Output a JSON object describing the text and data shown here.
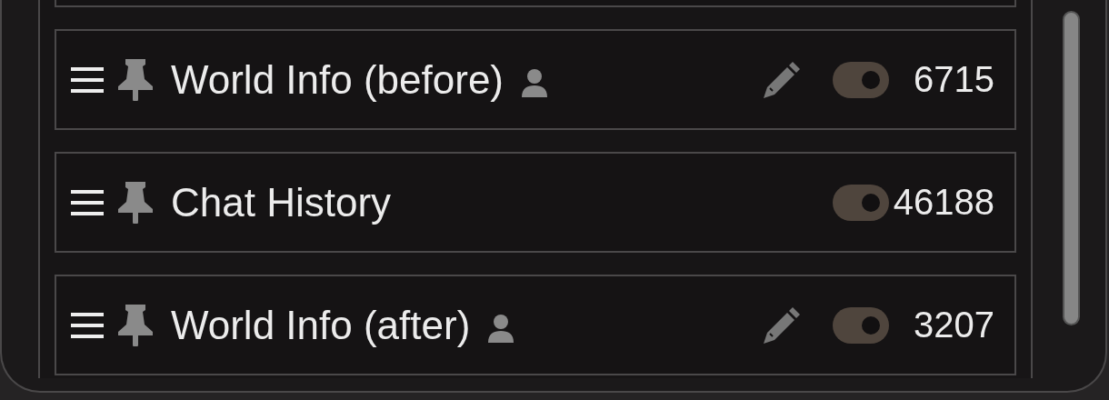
{
  "prompt_list": [
    {
      "name": "World Info (before)",
      "owner_icon": true,
      "editable": true,
      "on": true,
      "tokens": "6715"
    },
    {
      "name": "Chat History",
      "owner_icon": false,
      "editable": false,
      "on": true,
      "tokens": "46188"
    },
    {
      "name": "World Info (after)",
      "owner_icon": true,
      "editable": true,
      "on": true,
      "tokens": "3207"
    }
  ]
}
